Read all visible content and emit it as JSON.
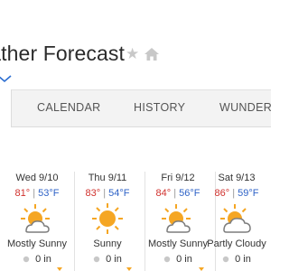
{
  "header": {
    "title": "Weather Forecast",
    "star_icon": "star-icon",
    "home_icon": "home-icon",
    "dropdown_icon": "chevron-down-icon",
    "accent": "#2b6dd1"
  },
  "tabs": [
    {
      "label": "CALENDAR"
    },
    {
      "label": "HISTORY"
    },
    {
      "label": "WUNDERM"
    }
  ],
  "forecast": [
    {
      "date": "Wed 9/10",
      "high": "81°",
      "low": "53°F",
      "condition": "Mostly Sunny",
      "precip": "0 in",
      "icon": "mostly-sunny-icon"
    },
    {
      "date": "Thu 9/11",
      "high": "83°",
      "low": "54°F",
      "condition": "Sunny",
      "precip": "0 in",
      "icon": "sunny-icon"
    },
    {
      "date": "Fri 9/12",
      "high": "84°",
      "low": "56°F",
      "condition": "Mostly Sunny",
      "precip": "0 in",
      "icon": "mostly-sunny-icon"
    },
    {
      "date": "Sat 9/13",
      "high": "86°",
      "low": "59°F",
      "condition": "Partly Cloudy",
      "precip": "0 in",
      "icon": "partly-cloudy-icon"
    }
  ],
  "colors": {
    "high_temp": "#d0312d",
    "low_temp": "#2f63c7",
    "sun": "#f5a623"
  }
}
